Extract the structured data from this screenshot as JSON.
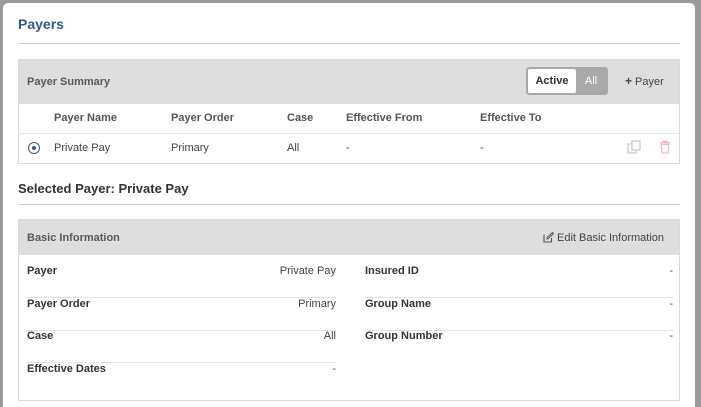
{
  "page": {
    "title": "Payers"
  },
  "payer_summary": {
    "title": "Payer Summary",
    "toggle": {
      "active_label": "Active",
      "all_label": "All",
      "selected": "Active"
    },
    "add_payer_label": "Payer",
    "columns": [
      "Payer Name",
      "Payer Order",
      "Case",
      "Effective From",
      "Effective To"
    ],
    "rows": [
      {
        "selected": true,
        "payer_name": "Private Pay",
        "payer_order": "Primary",
        "case": "All",
        "effective_from": "-",
        "effective_to": "-"
      }
    ]
  },
  "selected_payer": {
    "title": "Selected Payer: Private Pay"
  },
  "basic_info": {
    "title": "Basic Information",
    "edit_label": "Edit Basic Information",
    "left": [
      {
        "label": "Payer",
        "value": "Private Pay"
      },
      {
        "label": "Payer Order",
        "value": "Primary"
      },
      {
        "label": "Case",
        "value": "All"
      },
      {
        "label": "Effective Dates",
        "value": "-"
      }
    ],
    "right": [
      {
        "label": "Insured ID",
        "value": "-"
      },
      {
        "label": "Group Name",
        "value": "-"
      },
      {
        "label": "Group Number",
        "value": "-"
      }
    ]
  },
  "icons": {
    "copy": "copy-icon",
    "delete": "trash-icon",
    "edit": "edit-icon",
    "add": "plus-icon",
    "radio": "radio-selected-icon"
  },
  "colors": {
    "title_blue": "#2f5b85",
    "header_gray": "#dedede",
    "toggle_gray": "#a9a9a9",
    "delete_red": "#f2b8b8"
  }
}
